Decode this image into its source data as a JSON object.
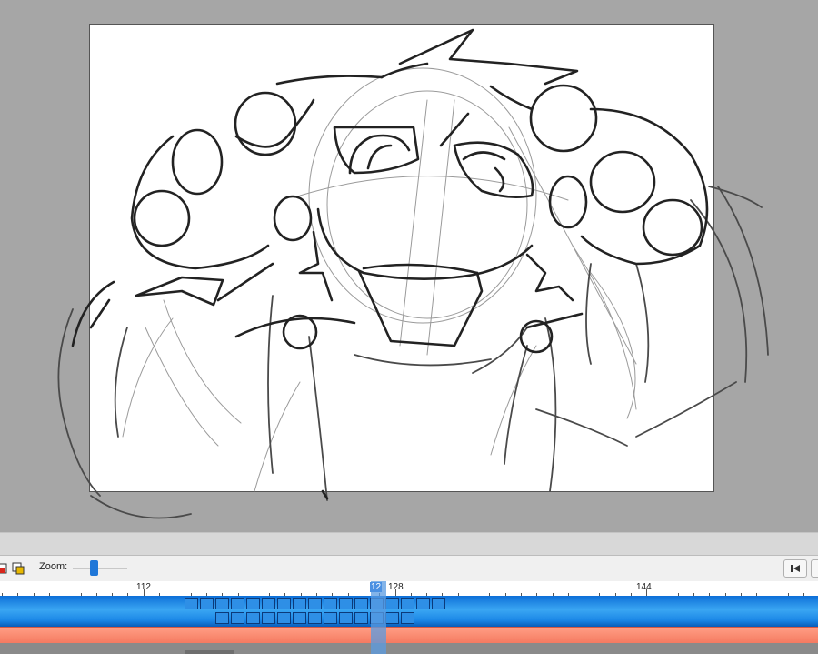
{
  "timeline": {
    "zoom_label": "Zoom:",
    "zoom_level": 0.35,
    "ruler_labels": [
      "112",
      "128",
      "144"
    ],
    "playhead_label": "12",
    "current_frame": 127
  },
  "icons": {
    "toolbar_left": "layer-icon",
    "toolbar_right": "duplicate-frame-icon",
    "first_frame": "skip-to-start-icon"
  },
  "colors": {
    "canvas_background": "#a6a6a6",
    "frame_track": "#1a86e6",
    "sound_track": "#f4785f",
    "playhead": "#4a90e2"
  }
}
